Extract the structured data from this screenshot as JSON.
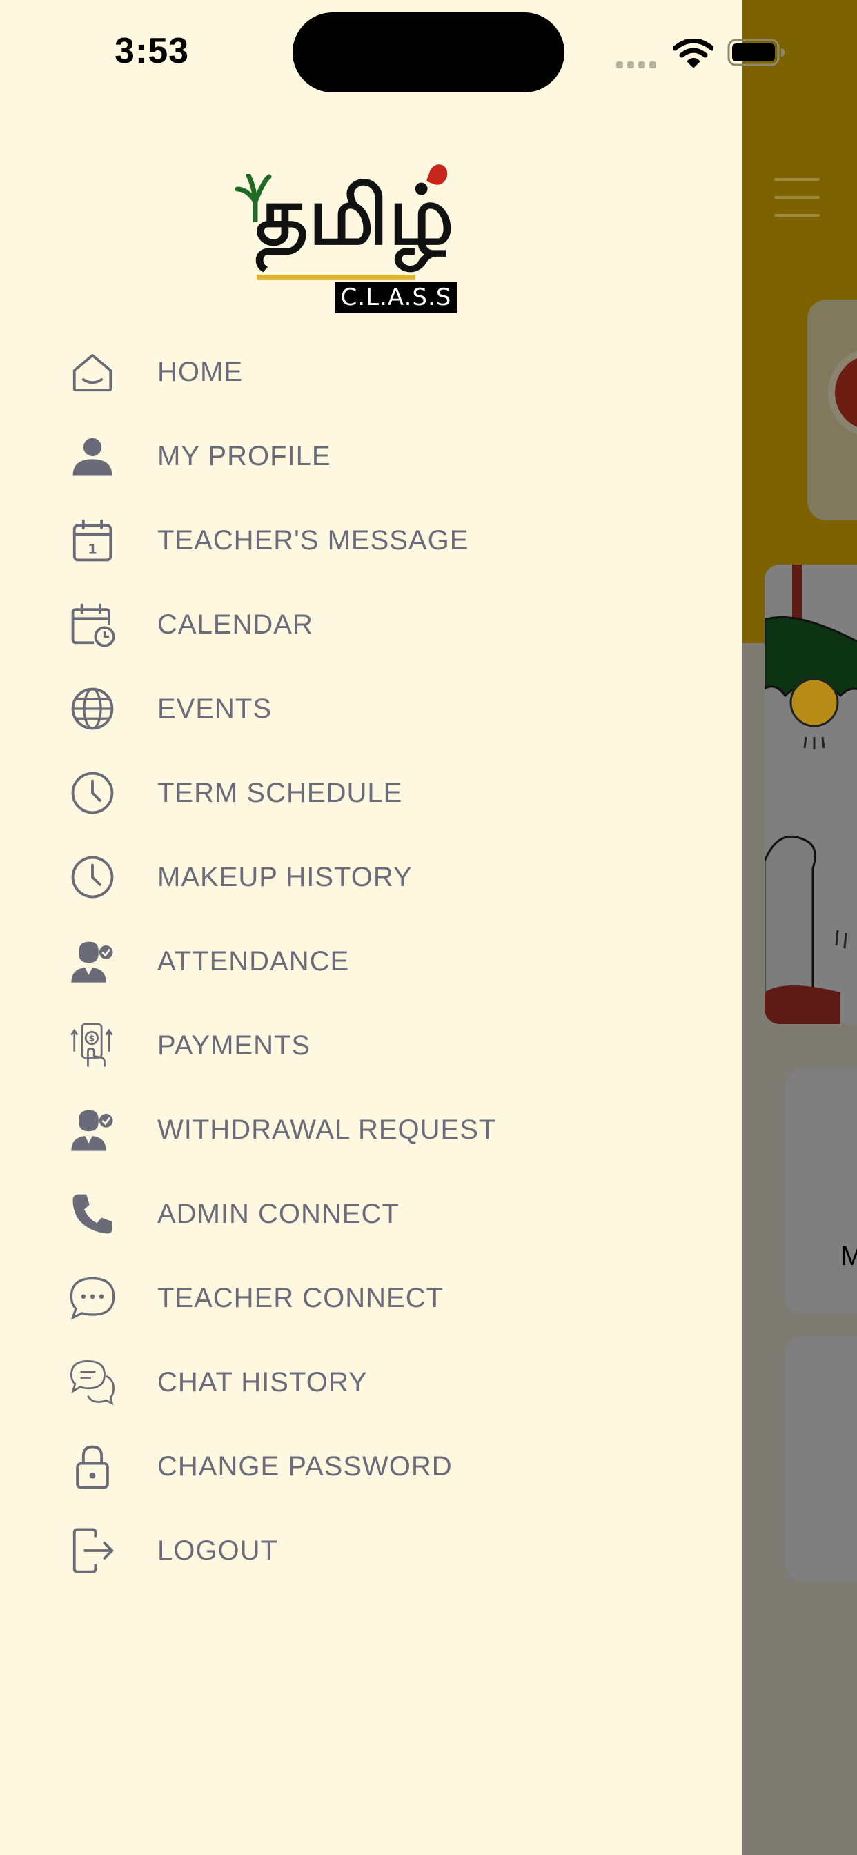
{
  "status_bar": {
    "time": "3:53"
  },
  "colors": {
    "drawer_background": "#FEF8E0",
    "menu_text": "#6B6B7B",
    "menu_icon": "#6A6A78",
    "header_behind": "#7C6300",
    "logo_underline": "#E2B531",
    "logo_dot": "#C8251B"
  },
  "logo": {
    "script_text": "தமிழ்",
    "badge_text": "C.L.A.S.S"
  },
  "menu": {
    "items": [
      {
        "label": "HOME",
        "icon": "home-icon"
      },
      {
        "label": "MY PROFILE",
        "icon": "person-icon"
      },
      {
        "label": "TEACHER'S MESSAGE",
        "icon": "calendar-day-icon"
      },
      {
        "label": "CALENDAR",
        "icon": "calendar-clock-icon"
      },
      {
        "label": "EVENTS",
        "icon": "globe-icon"
      },
      {
        "label": "TERM SCHEDULE",
        "icon": "clock-icon"
      },
      {
        "label": "MAKEUP HISTORY",
        "icon": "clock-icon"
      },
      {
        "label": "ATTENDANCE",
        "icon": "user-check-icon"
      },
      {
        "label": "PAYMENTS",
        "icon": "mobile-payment-icon"
      },
      {
        "label": "WITHDRAWAL REQUEST",
        "icon": "user-check-icon"
      },
      {
        "label": "ADMIN CONNECT",
        "icon": "phone-icon"
      },
      {
        "label": "TEACHER CONNECT",
        "icon": "chat-bubble-icon"
      },
      {
        "label": "CHAT HISTORY",
        "icon": "chat-history-icon"
      },
      {
        "label": "CHANGE PASSWORD",
        "icon": "lock-icon"
      },
      {
        "label": "LOGOUT",
        "icon": "logout-icon"
      }
    ]
  },
  "background_app": {
    "card_partial_text": "M"
  }
}
